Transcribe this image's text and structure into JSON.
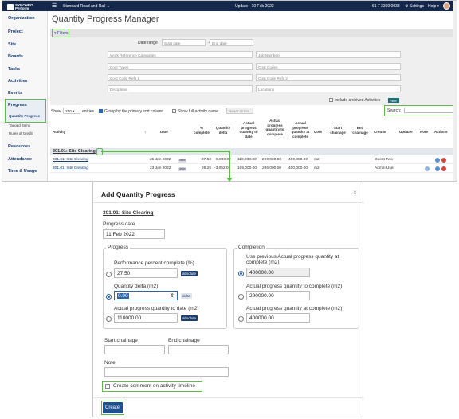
{
  "topbar": {
    "menu_icon": "hamburger-icon",
    "menu_glyph": "☰",
    "project": "Standard Road and Rail ⌄",
    "update": "Update - 10 Feb 2022",
    "phone": "+61 7 3369 0038",
    "settings": "⚙ Settings",
    "help": "Help ▾"
  },
  "logo": {
    "line1": "SYNCHRO",
    "line2": "Perform"
  },
  "sidebar": {
    "items": [
      {
        "label": "Organization"
      },
      {
        "label": "Project"
      },
      {
        "label": "Site"
      },
      {
        "label": "Boards"
      },
      {
        "label": "Tasks"
      },
      {
        "label": "Activities"
      },
      {
        "label": "Events"
      },
      {
        "label": "Progress"
      },
      {
        "label": "Quantity Progress"
      },
      {
        "label": "Tagged Items"
      },
      {
        "label": "Rules of Credit"
      },
      {
        "label": "Resources"
      },
      {
        "label": "Attendance"
      },
      {
        "label": "Time & Usage"
      }
    ]
  },
  "page": {
    "title": "Quantity Progress Manager",
    "filters_toggle": "▾ Filters"
  },
  "filters": {
    "date_range_label": "Date range",
    "start_placeholder": "Start date",
    "end_placeholder": "End date",
    "arrow": "→",
    "fields": [
      "Work Reference Categories",
      "Job Numbers",
      "Cost Types",
      "Cost Codes",
      "Cost Code Refs 1",
      "Cost Code Refs 2",
      "Disciplines",
      "Locations"
    ],
    "archived_label": "Include archived Activities",
    "filter_button": "Filter"
  },
  "table_controls": {
    "show": "Show",
    "entries_value": "250 ▾",
    "entries": "entries",
    "group_label": "Group by the primary sort column",
    "full_name_label": "Show full activity name",
    "reset_order": "Reset Order",
    "search_label": "Search:"
  },
  "table": {
    "headers": [
      "Activity",
      "Date",
      "% complete",
      "Quantity delta",
      "Actual progress quantity to date",
      "Actual progress quantity to complete",
      "Actual progress quantity at complete",
      "UoM",
      "Start chainage",
      "End chainage",
      "Creator",
      "Updater",
      "Note",
      "Actions"
    ],
    "group": "301.01: Site Clearing",
    "rows": [
      {
        "activity": "301.01: Site Clearing",
        "date": "25 Jan 2022",
        "tag": "delta",
        "pct": "27.50",
        "delta": "5,000.00",
        "to_date": "110,000.00",
        "to_complete": "290,000.00",
        "at_complete": "400,000.00",
        "uom": "m2",
        "creator": "Guest Two",
        "updater": ""
      },
      {
        "activity": "301.01: Site Clearing",
        "date": "23 Jan 2022",
        "tag": "delta",
        "pct": "26.25",
        "delta": "-3,052.00",
        "to_date": "105,000.00",
        "to_complete": "295,000.00",
        "at_complete": "400,000.00",
        "uom": "m2",
        "creator": "Admin User",
        "updater": ""
      }
    ]
  },
  "dialog": {
    "title": "Add Quantity Progress",
    "close": "×",
    "activity": "301.01: Site Clearing",
    "progress_date_label": "Progress date",
    "progress_date": "11 Feb 2022",
    "progress_legend": "Progress",
    "perf_label": "Performance percent complete (%)",
    "perf_value": "27.50",
    "qty_delta_label": "Quantity delta (m2)",
    "qty_delta_value": "0.00",
    "actual_to_date_label": "Actual progress quantity to date (m2)",
    "actual_to_date_value": "110000.00",
    "absolute": "absolute",
    "delta": "delta",
    "completion_legend": "Completion",
    "use_prev_label_1": "Use previous Actual progress quantity at",
    "use_prev_label_2": "complete (m2)",
    "use_prev_value": "400000.00",
    "to_complete_label": "Actual progress quantity to complete (m2)",
    "to_complete_value": "290000.00",
    "at_complete_label": "Actual progress quantity at complete (m2)",
    "at_complete_value": "400000.00",
    "start_chainage_label": "Start chainage",
    "end_chainage_label": "End chainage",
    "note_label": "Note",
    "comment_label": "Create comment on activity timeline",
    "create": "Create"
  },
  "colors": {
    "highlight": "#5cb94a",
    "topbar": "#14284b",
    "accent": "#1f4f8f"
  }
}
